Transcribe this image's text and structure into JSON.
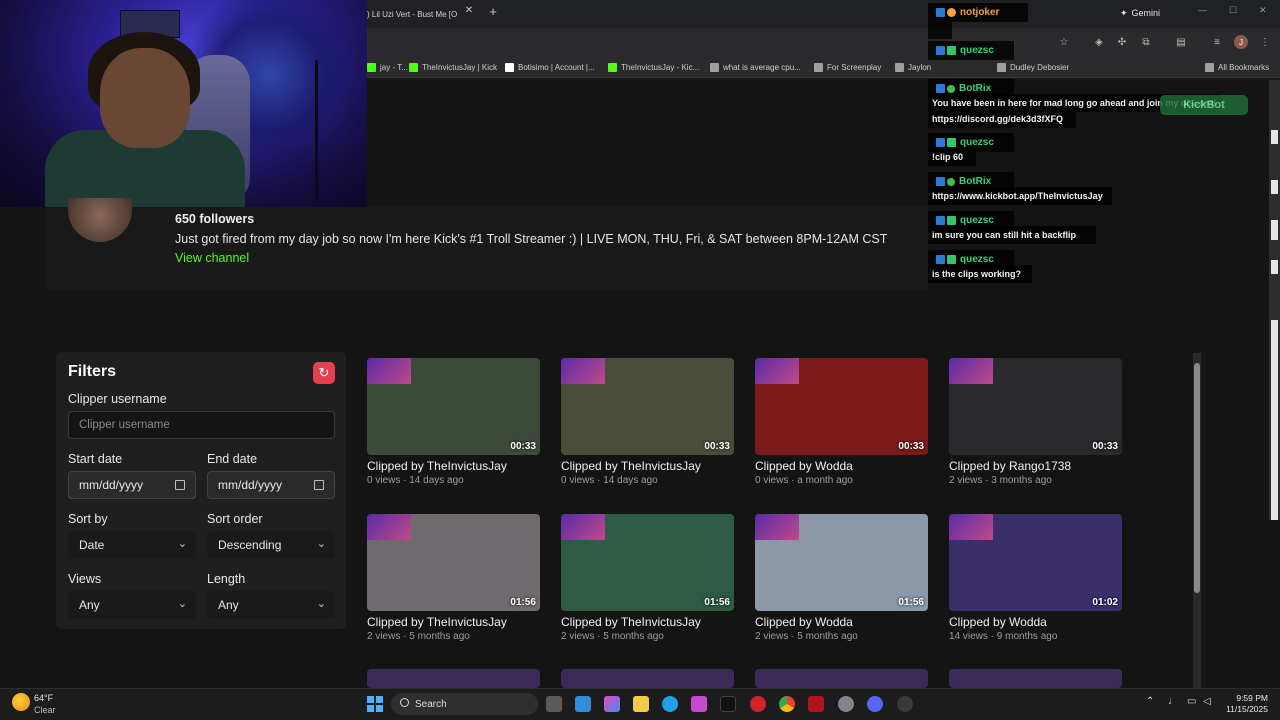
{
  "browser": {
    "active_tab": ") Lil Uzi Vert - Bust Me [O",
    "new_tab": "+",
    "close": "✕",
    "gemini": "Gemini",
    "bookmarks": [
      {
        "label": "jay - T...",
        "color": "#53fc18"
      },
      {
        "label": "TheInvictusJay | Kick",
        "color": "#53fc18"
      },
      {
        "label": "Botisimo | Account |...",
        "color": "#ffffff"
      },
      {
        "label": "TheInvictusJay - Kic...",
        "color": "#53fc18"
      },
      {
        "label": "what is average cpu...",
        "color": "#9aa0a6"
      },
      {
        "label": "For Screenplay",
        "color": "#9aa0a6"
      },
      {
        "label": "Jaylon",
        "color": "#9aa0a6"
      },
      {
        "label": "Dudley Debosier",
        "color": "#9aa0a6"
      },
      {
        "label": "All Bookmarks",
        "color": "#9aa0a6"
      }
    ]
  },
  "channel": {
    "followers": "650 followers",
    "bio": "Just got fired from my day job so now I'm here Kick's #1 Troll Streamer :) | LIVE MON, THU, Fri, & SAT between 8PM-12AM CST",
    "view_channel": "View channel"
  },
  "chat": {
    "kickbot": "KickBot",
    "messages": [
      {
        "user": "notjoker",
        "color": "#f2a33a",
        "text": ""
      },
      {
        "user": "quezsc",
        "color": "#34d27a",
        "text": ""
      },
      {
        "user": "BotRix",
        "color": "#34d27a",
        "text": "You have been in here for mad long go ahead and join my discord!"
      },
      {
        "user": "",
        "color": "",
        "text": "https://discord.gg/dek3d3fXFQ"
      },
      {
        "user": "quezsc",
        "color": "#34d27a",
        "text": "!clip 60"
      },
      {
        "user": "BotRix",
        "color": "#34d27a",
        "text": "https://www.kickbot.app/TheInvictusJay"
      },
      {
        "user": "quezsc",
        "color": "#34d27a",
        "text": "im sure you can still hit a backflip"
      },
      {
        "user": "quezsc",
        "color": "#34d27a",
        "text": "is the clips working?"
      }
    ]
  },
  "filters": {
    "title": "Filters",
    "clipper_label": "Clipper username",
    "clipper_placeholder": "Clipper username",
    "start_label": "Start date",
    "start_value": "mm/dd/yyyy",
    "end_label": "End date",
    "end_value": "mm/dd/yyyy",
    "sortby_label": "Sort by",
    "sortby_value": "Date",
    "sortorder_label": "Sort order",
    "sortorder_value": "Descending",
    "views_label": "Views",
    "views_value": "Any",
    "length_label": "Length",
    "length_value": "Any"
  },
  "clips": [
    {
      "duration": "00:33",
      "title": "Clipped by TheInvictusJay",
      "meta": "0 views · 14 days ago",
      "bg": "#3d4a3a"
    },
    {
      "duration": "00:33",
      "title": "Clipped by TheInvictusJay",
      "meta": "0 views · 14 days ago",
      "bg": "#4a4d3a"
    },
    {
      "duration": "00:33",
      "title": "Clipped by Wodda",
      "meta": "0 views · a month ago",
      "bg": "#7a1a1a"
    },
    {
      "duration": "00:33",
      "title": "Clipped by Rango1738",
      "meta": "2 views · 3 months ago",
      "bg": "#2a2a2e"
    },
    {
      "duration": "01:56",
      "title": "Clipped by TheInvictusJay",
      "meta": "2 views · 5 months ago",
      "bg": "#6f6a6e"
    },
    {
      "duration": "01:56",
      "title": "Clipped by TheInvictusJay",
      "meta": "2 views · 5 months ago",
      "bg": "#2f5a45"
    },
    {
      "duration": "01:56",
      "title": "Clipped by Wodda",
      "meta": "2 views · 5 months ago",
      "bg": "#8a98a8"
    },
    {
      "duration": "01:02",
      "title": "Clipped by Wodda",
      "meta": "14 views · 9 months ago",
      "bg": "#3a2f6a"
    }
  ],
  "taskbar": {
    "temp": "64°F",
    "cond": "Clear",
    "search": "Search",
    "time": "9:59 PM",
    "date": "11/15/2025"
  }
}
